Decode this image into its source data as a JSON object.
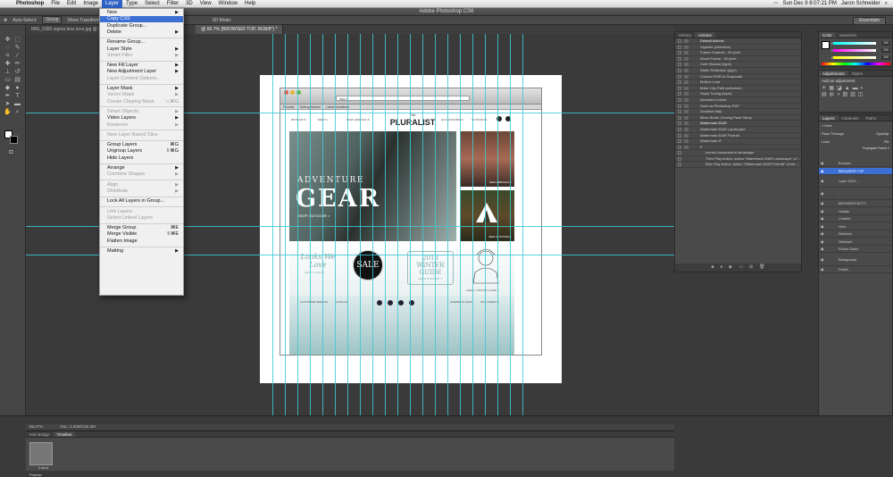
{
  "menubar": {
    "app": "Photoshop",
    "items": [
      "File",
      "Edit",
      "Image",
      "Layer",
      "Type",
      "Select",
      "Filter",
      "3D",
      "View",
      "Window",
      "Help"
    ],
    "active": "Layer",
    "status": {
      "clock": "Sun Dec 9  8:07:21 PM",
      "user": "Jaron Schneider"
    }
  },
  "titlebar": {
    "title": "Adobe Photoshop CS6"
  },
  "options": {
    "auto_select": "Auto-Select:",
    "group": "Group",
    "transform": "Show Transform",
    "mode_3d": "3D Mode:",
    "workspace": "Essentials"
  },
  "doc_tabs": [
    {
      "label": "IMG_0380 sigma lens lens.jpg @ 33.3%"
    },
    {
      "label": "@ 66.7% (BROWSER TOP, RGB/8*) *"
    }
  ],
  "layer_menu": [
    {
      "label": "New",
      "arrow": true
    },
    {
      "label": "Copy CSS",
      "highlight": true
    },
    {
      "label": "Duplicate Group..."
    },
    {
      "label": "Delete",
      "arrow": true
    },
    {
      "sep": true
    },
    {
      "label": "Rename Group..."
    },
    {
      "label": "Layer Style",
      "arrow": true
    },
    {
      "label": "Smart Filter",
      "disabled": true,
      "arrow": true
    },
    {
      "sep": true
    },
    {
      "label": "New Fill Layer",
      "arrow": true
    },
    {
      "label": "New Adjustment Layer",
      "arrow": true
    },
    {
      "label": "Layer Content Options...",
      "disabled": true
    },
    {
      "sep": true
    },
    {
      "label": "Layer Mask",
      "arrow": true
    },
    {
      "label": "Vector Mask",
      "disabled": true,
      "arrow": true
    },
    {
      "label": "Create Clipping Mask",
      "disabled": true,
      "shortcut": "⌥⌘G"
    },
    {
      "sep": true
    },
    {
      "label": "Smart Objects",
      "disabled": true,
      "arrow": true
    },
    {
      "label": "Video Layers",
      "arrow": true
    },
    {
      "label": "Rasterize",
      "disabled": true,
      "arrow": true
    },
    {
      "sep": true
    },
    {
      "label": "New Layer Based Slice",
      "disabled": true
    },
    {
      "sep": true
    },
    {
      "label": "Group Layers",
      "shortcut": "⌘G"
    },
    {
      "label": "Ungroup Layers",
      "shortcut": "⇧⌘G"
    },
    {
      "label": "Hide Layers"
    },
    {
      "sep": true
    },
    {
      "label": "Arrange",
      "arrow": true
    },
    {
      "label": "Combine Shapes",
      "disabled": true,
      "arrow": true
    },
    {
      "sep": true
    },
    {
      "label": "Align",
      "disabled": true,
      "arrow": true
    },
    {
      "label": "Distribute",
      "disabled": true,
      "arrow": true
    },
    {
      "sep": true
    },
    {
      "label": "Lock All Layers in Group..."
    },
    {
      "sep": true
    },
    {
      "label": "Link Layers",
      "disabled": true
    },
    {
      "label": "Select Linked Layers",
      "disabled": true
    },
    {
      "sep": true
    },
    {
      "label": "Merge Group",
      "shortcut": "⌘E"
    },
    {
      "label": "Merge Visible",
      "shortcut": "⇧⌘E"
    },
    {
      "label": "Flatten Image"
    },
    {
      "sep": true
    },
    {
      "label": "Matting",
      "arrow": true
    }
  ],
  "history_panel": {
    "tabs": [
      "History",
      "Actions"
    ],
    "active": "Actions",
    "rows": [
      {
        "label": "Default Actions",
        "group": true
      },
      {
        "label": "Vignette (selection)"
      },
      {
        "label": "Frame Channel - 50 pixel"
      },
      {
        "label": "Wood Frame - 50 pixel"
      },
      {
        "label": "Cast Shadow (type)"
      },
      {
        "label": "Water Reflection (type)"
      },
      {
        "label": "Custom RGB to Grayscale"
      },
      {
        "label": "Molten Lead"
      },
      {
        "label": "Make Clip Path (selection)"
      },
      {
        "label": "Sepia Toning (layer)"
      },
      {
        "label": "Quadrant Colors"
      },
      {
        "label": "Save as Photoshop PDF"
      },
      {
        "label": "Gradient Map"
      },
      {
        "label": "Mixer Brush Cloning Paint Setup"
      },
      {
        "label": "Watermark iDAR",
        "group": true
      },
      {
        "label": "Watermark iDAR Landscape"
      },
      {
        "label": "Watermark iDAR Portrait"
      },
      {
        "label": "Watermark IF"
      },
      {
        "label": "If"
      },
      {
        "label": "current document is landscape"
      },
      {
        "label": "Then Play Action: action \"Watermark iDAR Landscape\" of ..."
      },
      {
        "label": "Else Play Action: action \"Watermark iDAR Portrait\" of set ..."
      }
    ]
  },
  "color_panel": {
    "tabs": [
      "Color",
      "Swatches"
    ],
    "channels": [
      {
        "name": "R",
        "value": "255"
      },
      {
        "name": "G",
        "value": "255"
      },
      {
        "name": "B",
        "value": "255"
      }
    ]
  },
  "adj_panel": {
    "tabs": [
      "Adjustments",
      "Styles"
    ],
    "title": "Add an adjustment"
  },
  "layers_panel": {
    "tabs": [
      "Layers",
      "Channels",
      "Paths"
    ],
    "kind": "Kind",
    "mode": "Pass Through",
    "opacity": "Opacity:",
    "lock": "Lock:",
    "fill": "Fill:",
    "propagate": "Propagate Frame 1",
    "layers": [
      {
        "label": "Browser"
      },
      {
        "label": "BROWSER TOP",
        "selected": true
      },
      {
        "label": "Layer 3213 ...",
        "tall": true
      },
      {
        "label": "...",
        "tall": true
      },
      {
        "label": "BROWSER BOTT..."
      },
      {
        "label": "Header"
      },
      {
        "label": "Content"
      },
      {
        "label": "Hero"
      },
      {
        "label": "Sidebar1"
      },
      {
        "label": "Sidebar2"
      },
      {
        "label": "Promo Gains"
      },
      {
        "label": "Background",
        "tall": true
      },
      {
        "label": "Footer"
      }
    ]
  },
  "status": {
    "zoom": "66.67%",
    "doc": "Doc: 4.93M/126.3M"
  },
  "bottom": {
    "tabs": [
      "Mini Bridge",
      "Timeline"
    ],
    "forever": "Forever"
  },
  "site": {
    "logo_small": "The",
    "logo": "PLURALIST",
    "nav": [
      "WOMEN'S",
      "MEN'S",
      "NEW ARRIVALS",
      "ACCESSORIES",
      "OUTDOOR"
    ],
    "hero_line1": "ADVENTURE",
    "hero_line2": "GEAR",
    "hero_cta": "SHOP OUTDOOR  >",
    "girl_cta": "NEW ARRIVALS  >",
    "tent_cta": "NEW OUTDOOR  >",
    "promo_looks": "Looks We Love",
    "promo_looks_sub": "SHOP LOOKS >",
    "sale": "SALE",
    "winter_year": "2013",
    "winter_title": "WINTER GUIDE",
    "winter_sub": "SHOP WINTER >",
    "sketch_caption": "SHELL / WINTER GUIDE >",
    "footer_left": [
      "CUSTOMER SERVICE",
      "CATALOG"
    ],
    "footer_right": [
      "WHERE TO SHOP",
      "SITE CREDITS"
    ],
    "url": "http://",
    "bookmarks": [
      "Pluralist",
      "Getting Started",
      "Latest Headlines"
    ]
  }
}
